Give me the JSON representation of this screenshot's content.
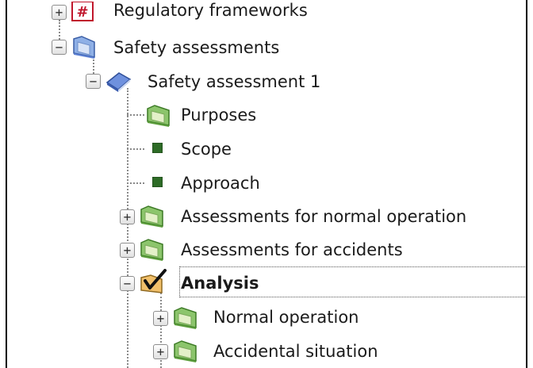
{
  "tree": {
    "items": [
      {
        "label": "Regulatory frameworks",
        "expander": "+"
      },
      {
        "label": "Safety assessments",
        "expander": "−"
      },
      {
        "label": "Safety assessment 1",
        "expander": "−"
      },
      {
        "label": "Purposes"
      },
      {
        "label": "Scope"
      },
      {
        "label": "Approach"
      },
      {
        "label": "Assessments for normal operation",
        "expander": "+"
      },
      {
        "label": "Assessments for accidents",
        "expander": "+"
      },
      {
        "label": "Analysis",
        "expander": "−",
        "selected": true
      },
      {
        "label": "Normal operation",
        "expander": "+"
      },
      {
        "label": "Accidental situation",
        "expander": "+"
      }
    ]
  },
  "colors": {
    "folder_green": "#5c9e3c",
    "scope_square": "#2d6b26",
    "accent_red": "#c0162c",
    "book_blue": "#5b7fd3"
  }
}
